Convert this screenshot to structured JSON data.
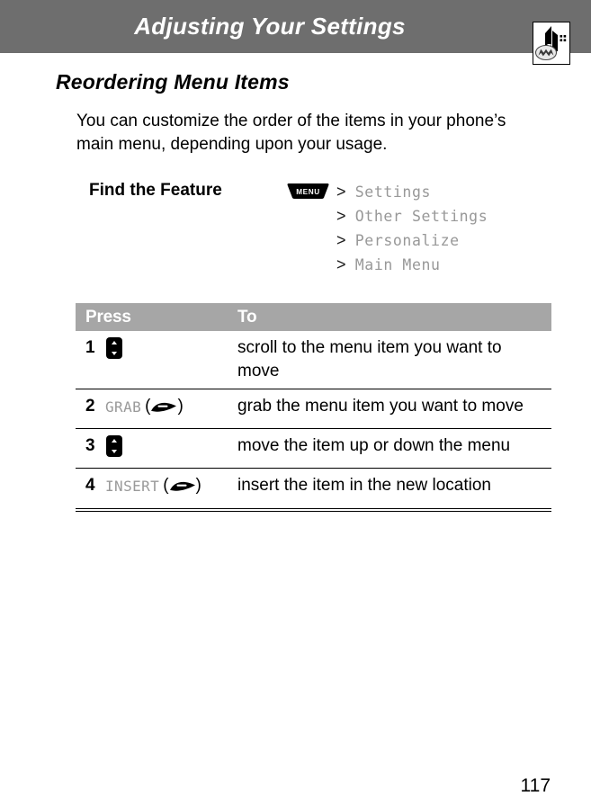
{
  "header": {
    "title": "Adjusting Your Settings",
    "badge_icon": "motorola-tower-icon",
    "bar_color": "#6e6e6e"
  },
  "section": {
    "heading": "Reordering Menu Items",
    "intro": "You can customize the order of the items in your phone’s main menu, depending upon your usage."
  },
  "find_the_feature": {
    "label": "Find the Feature",
    "menu_key_label": "MENU",
    "menu_key_icon": "menu-soft-key-icon",
    "chevron": ">",
    "path": [
      "Settings",
      "Other Settings",
      "Personalize",
      "Main Menu"
    ]
  },
  "steps_table": {
    "headers": {
      "press": "Press",
      "to": "To"
    },
    "header_bg": "#a6a6a6",
    "rows": [
      {
        "num": "1",
        "key_icon": "nav-up-down-key-icon",
        "key_label": "",
        "has_paren_key": false,
        "to": "scroll to the menu item you want to move"
      },
      {
        "num": "2",
        "key_icon": "soft-key-icon",
        "key_label": "GRAB",
        "has_paren_key": true,
        "to": "grab the menu item you want to move"
      },
      {
        "num": "3",
        "key_icon": "nav-up-down-key-icon",
        "key_label": "",
        "has_paren_key": false,
        "to": "move the item up or down the menu"
      },
      {
        "num": "4",
        "key_icon": "soft-key-icon",
        "key_label": "INSERT",
        "has_paren_key": true,
        "to": "insert the item in the new location"
      }
    ]
  },
  "footer": {
    "page_number": "117"
  }
}
